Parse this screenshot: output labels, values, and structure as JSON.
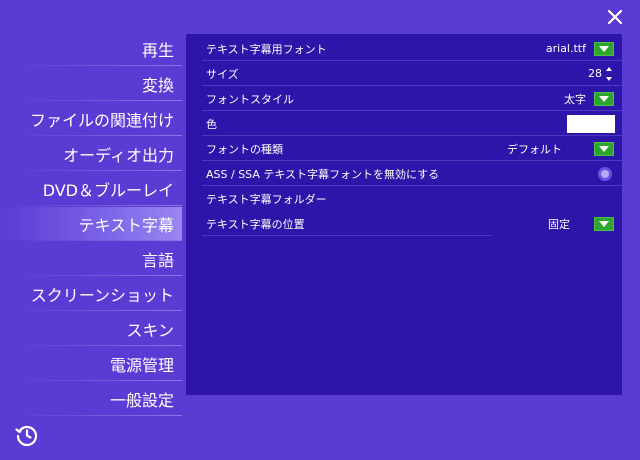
{
  "window": {
    "close_icon": "close-x-icon",
    "history_icon": "history-icon"
  },
  "sidebar": {
    "items": [
      {
        "label": "再生",
        "active": false
      },
      {
        "label": "変換",
        "active": false
      },
      {
        "label": "ファイルの関連付け",
        "active": false
      },
      {
        "label": "オーディオ出力",
        "active": false
      },
      {
        "label": "DVD＆ブルーレイ",
        "active": false
      },
      {
        "label": "テキスト字幕",
        "active": true
      },
      {
        "label": "言語",
        "active": false
      },
      {
        "label": "スクリーンショット",
        "active": false
      },
      {
        "label": "スキン",
        "active": false
      },
      {
        "label": "電源管理",
        "active": false
      },
      {
        "label": "一般設定",
        "active": false
      }
    ]
  },
  "settings": {
    "font": {
      "label": "テキスト字幕用フォント",
      "value": "arial.ttf"
    },
    "size": {
      "label": "サイズ",
      "value": "28"
    },
    "style": {
      "label": "フォントスタイル",
      "value": "太字"
    },
    "color": {
      "label": "色",
      "value_color": "#ffffff"
    },
    "type": {
      "label": "フォントの種類",
      "value": "デフォルト"
    },
    "ass_disable": {
      "label": "ASS / SSA テキスト字幕フォントを無効にする"
    },
    "folder": {
      "label": "テキスト字幕フォルダー"
    },
    "position": {
      "label": "テキスト字幕の位置",
      "value": "固定"
    }
  },
  "colors": {
    "background": "#5a3bd4",
    "panel": "#2c15a8",
    "dropdown": "#2fa52f",
    "active_item": "#7a62e6"
  }
}
